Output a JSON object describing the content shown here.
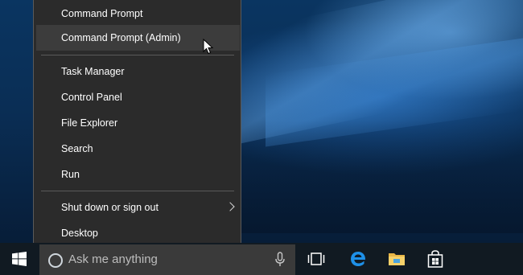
{
  "menu": {
    "items": [
      {
        "label": "Command Prompt"
      },
      {
        "label": "Command Prompt (Admin)"
      },
      {
        "label": "Task Manager"
      },
      {
        "label": "Control Panel"
      },
      {
        "label": "File Explorer"
      },
      {
        "label": "Search"
      },
      {
        "label": "Run"
      },
      {
        "label": "Shut down or sign out"
      },
      {
        "label": "Desktop"
      }
    ]
  },
  "taskbar": {
    "search_placeholder": "Ask me anything",
    "icons": [
      "windows-logo-icon",
      "cortana-icon",
      "microphone-icon",
      "task-view-icon",
      "edge-icon",
      "file-explorer-icon",
      "store-icon"
    ]
  },
  "colors": {
    "menu_bg": "#2b2b2b",
    "menu_hover": "#3c3c3c",
    "taskbar_bg": "#111a22",
    "search_bg": "#3a3a3a",
    "accent": "#0078d7"
  }
}
